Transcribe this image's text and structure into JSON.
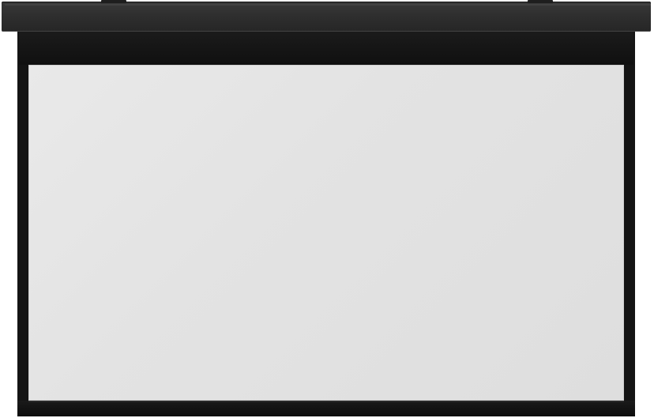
{
  "image": {
    "subject": "projector-screen",
    "colors": {
      "housing": "#2f2f2f",
      "frame": "#141414",
      "surface": "#e3e3e3",
      "background": "#ffffff"
    }
  }
}
